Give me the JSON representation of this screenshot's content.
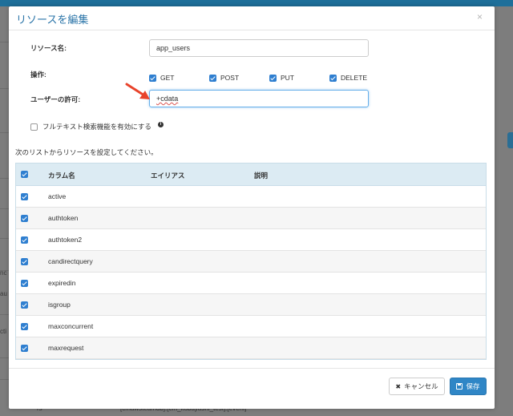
{
  "colors": {
    "accent": "#2a74a8",
    "primary_button": "#2f86c6",
    "checkbox": "#2f7fd0",
    "table_header_bg": "#dcebf3",
    "focus_border": "#66afe9",
    "arrow": "#e8432b"
  },
  "modal": {
    "title": "リソースを編集",
    "close_icon": "×"
  },
  "form": {
    "resource_name_label": "リソース名:",
    "resource_name_value": "app_users",
    "operations_label": "操作:",
    "operations": [
      {
        "label": "GET",
        "checked": true
      },
      {
        "label": "POST",
        "checked": true
      },
      {
        "label": "PUT",
        "checked": true
      },
      {
        "label": "DELETE",
        "checked": true
      }
    ],
    "user_permission_label": "ユーザーの許可:",
    "user_permission_value": "+cdata",
    "fulltext_label": "フルテキスト検索機能を有効にする",
    "fulltext_checked": false,
    "list_hint": "次のリストからリソースを設定してください。"
  },
  "table": {
    "headers": [
      "カラム名",
      "エイリアス",
      "説明"
    ],
    "rows": [
      {
        "name": "active",
        "checked": true
      },
      {
        "name": "authtoken",
        "checked": true
      },
      {
        "name": "authtoken2",
        "checked": true
      },
      {
        "name": "candirectquery",
        "checked": true
      },
      {
        "name": "expiredin",
        "checked": true
      },
      {
        "name": "isgroup",
        "checked": true
      },
      {
        "name": "maxconcurrent",
        "checked": true
      },
      {
        "name": "maxrequest",
        "checked": true
      }
    ]
  },
  "footer": {
    "cancel_label": "キャンセル",
    "save_label": "保存"
  },
  "background": {
    "fragments": [
      "nc",
      "au",
      "cti"
    ],
    "bottom_row_left": "rs",
    "bottom_row_right": "[cmawsteamdb].[cm_kobayashi_test].[event]"
  }
}
